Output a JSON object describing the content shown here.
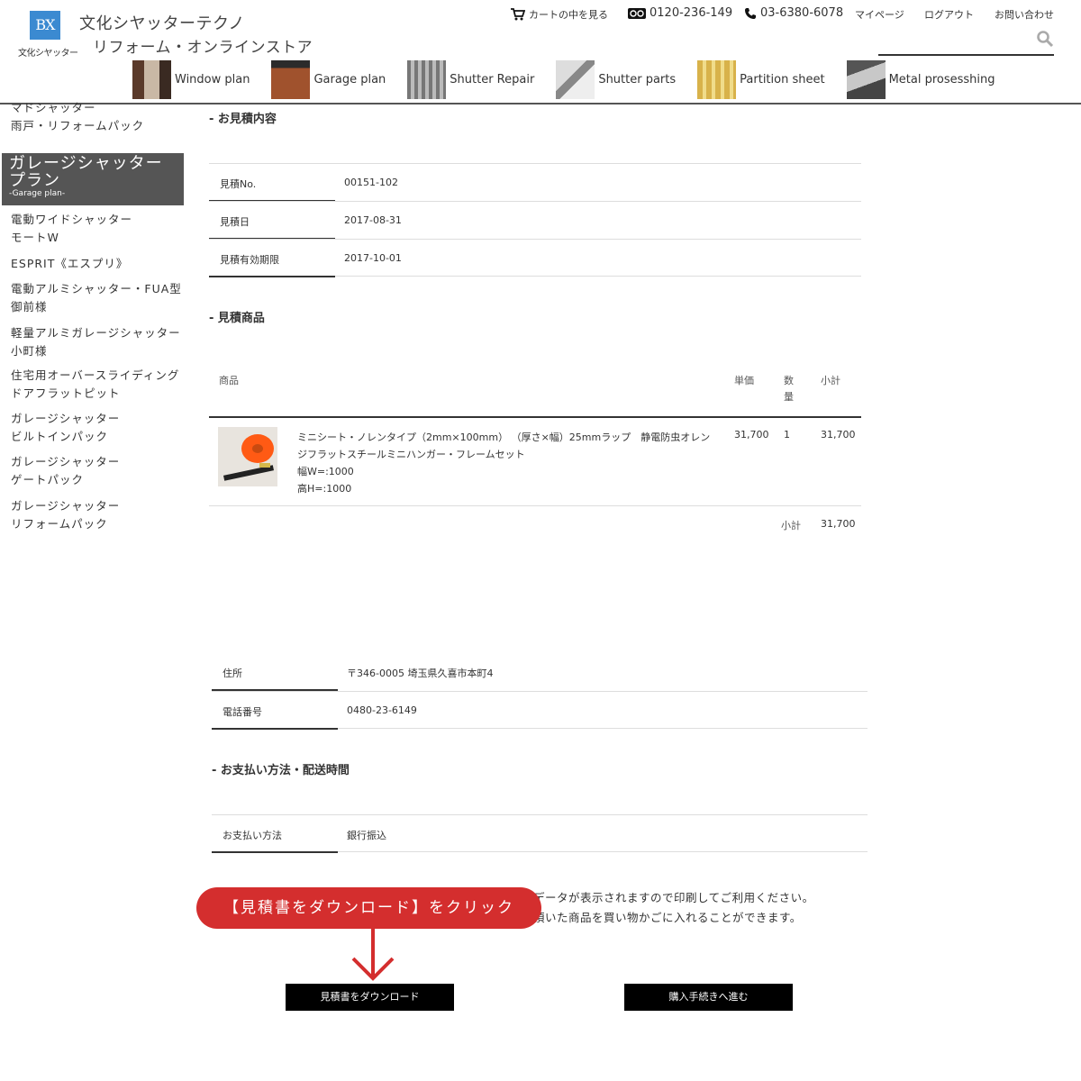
{
  "header": {
    "logo_mark": "BX",
    "logo_sub": "文化シヤッター",
    "brand_line1": "文化シヤッターテクノ",
    "brand_line2": "リフォーム・オンラインストア",
    "util": {
      "cart": "カートの中を見る",
      "freedial": "0120-236-149",
      "phone": "03-6380-6078",
      "mypage": "マイページ",
      "logout": "ログアウト",
      "contact": "お問い合わせ"
    },
    "search_placeholder": ""
  },
  "nav": [
    {
      "label": "Window plan",
      "icon": "window-plan-photo"
    },
    {
      "label": "Garage plan",
      "icon": "garage-plan-photo"
    },
    {
      "label": "Shutter Repair",
      "icon": "shutter-repair-photo"
    },
    {
      "label": "Shutter parts",
      "icon": "shutter-parts-photo"
    },
    {
      "label": "Partition sheet",
      "icon": "partition-sheet-photo"
    },
    {
      "label": "Metal prosesshing",
      "icon": "metal-processing-photo"
    }
  ],
  "sidebar": {
    "cut_item": "マドシャッター",
    "item_amado": "雨戸・リフォームパック",
    "active_title_1": "ガレージシャッター",
    "active_title_2": "プラン",
    "active_sub": "-Garage plan-",
    "items": [
      [
        "電動ワイドシャッター",
        "モートW"
      ],
      [
        "ESPRIT《エスプリ》"
      ],
      [
        "電動アルミシャッター・FUA型",
        "御前様"
      ],
      [
        "軽量アルミガレージシャッター",
        "小町様"
      ],
      [
        "住宅用オーバースライディング",
        "ドアフラットピット"
      ],
      [
        "ガレージシャッター",
        "ビルトインパック"
      ],
      [
        "ガレージシャッター",
        "ゲートパック"
      ],
      [
        "ガレージシャッター",
        "リフォームパック"
      ]
    ]
  },
  "quote": {
    "section_title": "- お見積内容",
    "rows": [
      {
        "label": "見積No.",
        "value": "00151-102"
      },
      {
        "label": "見積日",
        "value": "2017-08-31"
      },
      {
        "label": "見積有効期限",
        "value": "2017-10-01"
      }
    ]
  },
  "products": {
    "section_title": "- 見積商品",
    "headers": {
      "product": "商品",
      "unit_price": "単価",
      "qty_1": "数",
      "qty_2": "量",
      "subtotal": "小計"
    },
    "item": {
      "name_line1": "ミニシート・ノレンタイプ（2mm×100mm） （厚さ×幅）25mmラップ　静電防虫オレン",
      "name_line2": "ジフラットスチールミニハンガー・フレームセット",
      "width": "幅W=:1000",
      "height": "高H=:1000",
      "unit_price": "31,700",
      "qty": "1",
      "subtotal": "31,700"
    },
    "total_label": "小計",
    "total_value": "31,700"
  },
  "delivery": {
    "rows": [
      {
        "label": "住所",
        "value": "〒346-0005 埼玉県久喜市本町4"
      },
      {
        "label": "電話番号",
        "value": "0480-23-6149"
      }
    ]
  },
  "payment": {
    "section_title": "- お支払い方法・配送時間",
    "rows": [
      {
        "label": "お支払い方法",
        "value": "銀行振込"
      }
    ]
  },
  "notes": {
    "line1": "データが表示されますので印刷してご利用ください。",
    "line2": "頂いた商品を買い物かごに入れることができます。"
  },
  "callout": "【見積書をダウンロード】をクリック",
  "buttons": {
    "download": "見積書をダウンロード",
    "purchase": "購入手続きへ進む"
  },
  "colors": {
    "logo_blue": "#3b8ad1",
    "sidebar_active": "#555555",
    "callout_red": "#d42e2e",
    "button_black": "#000000",
    "product_orange": "#ff5a14"
  }
}
